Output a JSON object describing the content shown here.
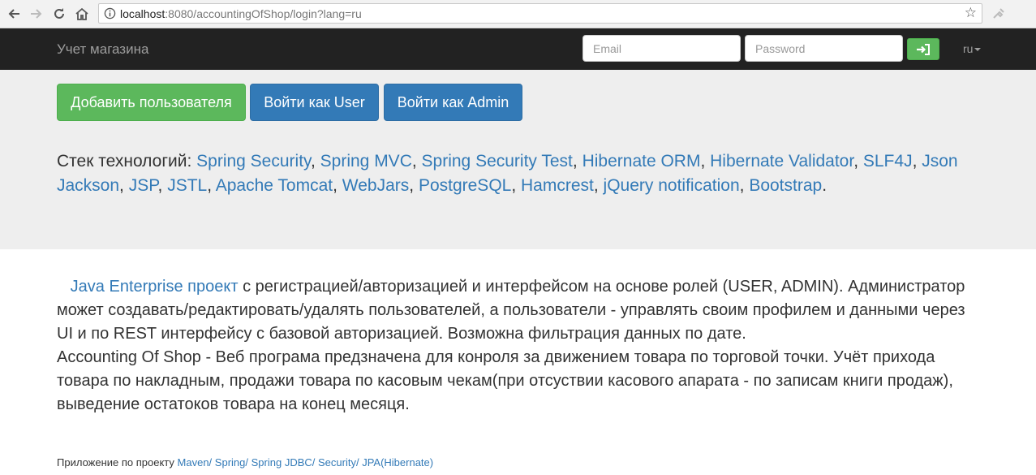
{
  "browser": {
    "url_host": "localhost",
    "url_path": ":8080/accountingOfShop/login?lang=ru"
  },
  "navbar": {
    "brand": "Учет магазина",
    "email_placeholder": "Email",
    "password_placeholder": "Password",
    "lang": "ru"
  },
  "jumbotron": {
    "buttons": {
      "add_user": "Добавить пользователя",
      "login_user": "Войти как User",
      "login_admin": "Войти как Admin"
    },
    "stack_label": "Стек технологий:",
    "stack": [
      "Spring Security",
      "Spring MVC",
      "Spring Security Test",
      "Hibernate ORM",
      "Hibernate Validator",
      "SLF4J",
      "Json Jackson",
      "JSP",
      "JSTL",
      "Apache Tomcat",
      "WebJars",
      "PostgreSQL",
      "Hamcrest",
      "jQuery notification",
      "Bootstrap"
    ]
  },
  "content": {
    "project_link": "Java Enterprise проект",
    "para1_rest": " с регистрацией/авторизацией и интерфейсом на основе ролей (USER, ADMIN). Администратор может создавать/редактировать/удалять пользователей, а пользователи - управлять своим профилем и данными через UI и по REST интерфейсу с базовой авторизацией. Возможна фильтрация данных по дате.",
    "para2": "Accounting Of Shop - Веб програма предзначена для конроля за движением товара по торговой точки. Учёт прихода товара по накладным, продажи товара по касовым чекам(при отсуствии касового апарата - по записам книги продаж), выведение остатоков товара на конец месяця.",
    "footer_label": "Приложение по проекту",
    "footer_links": [
      "Maven/",
      "Spring/",
      "Spring JDBC/",
      "Security/",
      "JPA(Hibernate)"
    ]
  },
  "colors": {
    "navbar_bg": "#222222",
    "success": "#5cb85c",
    "primary": "#337ab7",
    "jumbotron_bg": "#eeeeee",
    "link": "#337ab7"
  }
}
